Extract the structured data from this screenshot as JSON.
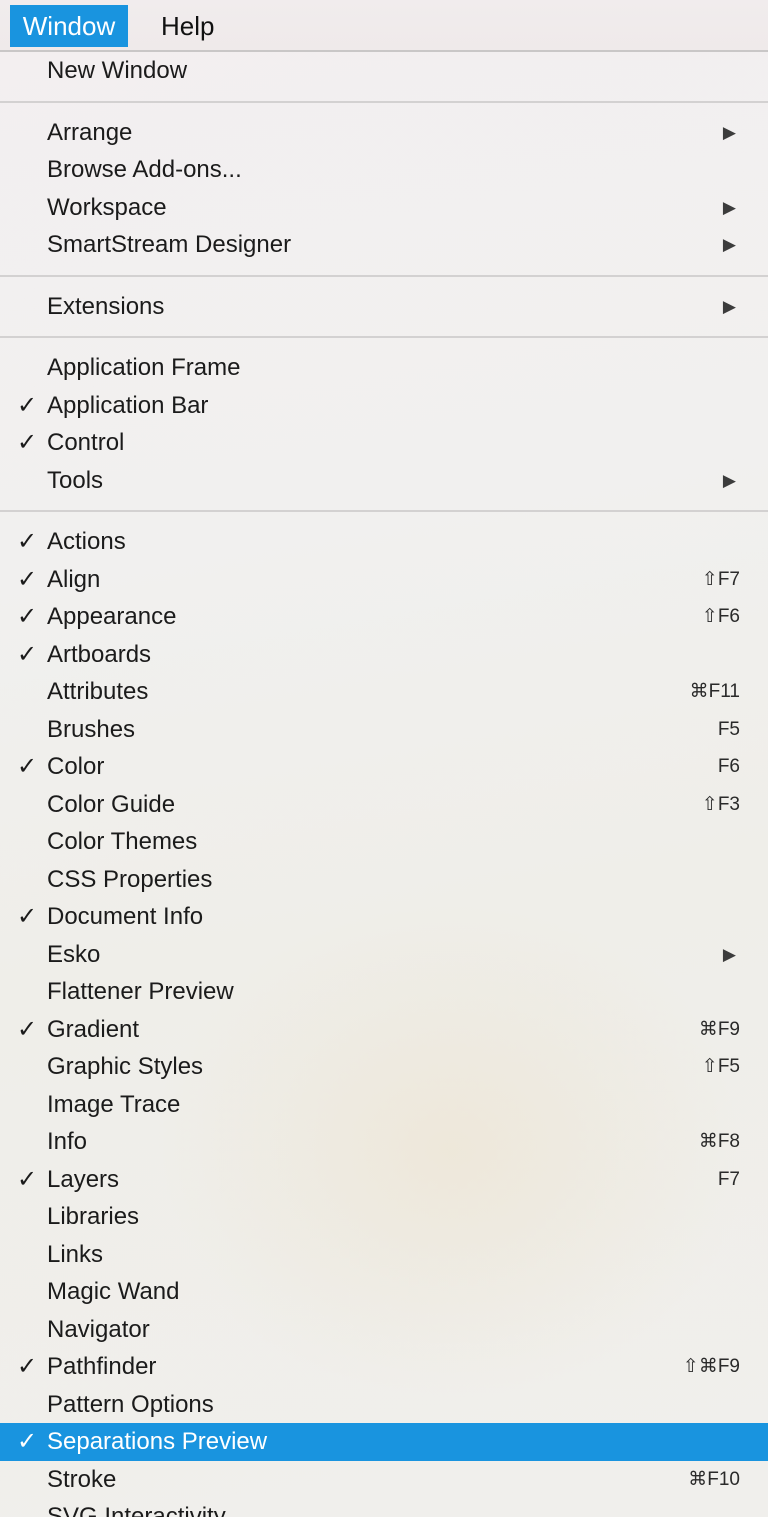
{
  "menubar": {
    "window_label": "Window",
    "help_label": "Help"
  },
  "colors": {
    "highlight": "#1994df",
    "separator": "#d3d1d1"
  },
  "icons": {
    "check": "✓",
    "submenu_arrow": "▶"
  },
  "groups": [
    [
      {
        "label": "New Window",
        "checked": false,
        "submenu": false,
        "shortcut": ""
      }
    ],
    [
      {
        "label": "Arrange",
        "checked": false,
        "submenu": true,
        "shortcut": ""
      },
      {
        "label": "Browse Add-ons...",
        "checked": false,
        "submenu": false,
        "shortcut": ""
      },
      {
        "label": "Workspace",
        "checked": false,
        "submenu": true,
        "shortcut": ""
      },
      {
        "label": "SmartStream Designer",
        "checked": false,
        "submenu": true,
        "shortcut": ""
      }
    ],
    [
      {
        "label": "Extensions",
        "checked": false,
        "submenu": true,
        "shortcut": ""
      }
    ],
    [
      {
        "label": "Application Frame",
        "checked": false,
        "submenu": false,
        "shortcut": ""
      },
      {
        "label": "Application Bar",
        "checked": true,
        "submenu": false,
        "shortcut": ""
      },
      {
        "label": "Control",
        "checked": true,
        "submenu": false,
        "shortcut": ""
      },
      {
        "label": "Tools",
        "checked": false,
        "submenu": true,
        "shortcut": ""
      }
    ],
    [
      {
        "label": "Actions",
        "checked": true,
        "submenu": false,
        "shortcut": ""
      },
      {
        "label": "Align",
        "checked": true,
        "submenu": false,
        "shortcut": "⇧F7"
      },
      {
        "label": "Appearance",
        "checked": true,
        "submenu": false,
        "shortcut": "⇧F6"
      },
      {
        "label": "Artboards",
        "checked": true,
        "submenu": false,
        "shortcut": ""
      },
      {
        "label": "Attributes",
        "checked": false,
        "submenu": false,
        "shortcut": "⌘F11"
      },
      {
        "label": "Brushes",
        "checked": false,
        "submenu": false,
        "shortcut": "F5"
      },
      {
        "label": "Color",
        "checked": true,
        "submenu": false,
        "shortcut": "F6"
      },
      {
        "label": "Color Guide",
        "checked": false,
        "submenu": false,
        "shortcut": "⇧F3"
      },
      {
        "label": "Color Themes",
        "checked": false,
        "submenu": false,
        "shortcut": ""
      },
      {
        "label": "CSS Properties",
        "checked": false,
        "submenu": false,
        "shortcut": ""
      },
      {
        "label": "Document Info",
        "checked": true,
        "submenu": false,
        "shortcut": ""
      },
      {
        "label": "Esko",
        "checked": false,
        "submenu": true,
        "shortcut": ""
      },
      {
        "label": "Flattener Preview",
        "checked": false,
        "submenu": false,
        "shortcut": ""
      },
      {
        "label": "Gradient",
        "checked": true,
        "submenu": false,
        "shortcut": "⌘F9"
      },
      {
        "label": "Graphic Styles",
        "checked": false,
        "submenu": false,
        "shortcut": "⇧F5"
      },
      {
        "label": "Image Trace",
        "checked": false,
        "submenu": false,
        "shortcut": ""
      },
      {
        "label": "Info",
        "checked": false,
        "submenu": false,
        "shortcut": "⌘F8"
      },
      {
        "label": "Layers",
        "checked": true,
        "submenu": false,
        "shortcut": "F7"
      },
      {
        "label": "Libraries",
        "checked": false,
        "submenu": false,
        "shortcut": ""
      },
      {
        "label": "Links",
        "checked": false,
        "submenu": false,
        "shortcut": ""
      },
      {
        "label": "Magic Wand",
        "checked": false,
        "submenu": false,
        "shortcut": ""
      },
      {
        "label": "Navigator",
        "checked": false,
        "submenu": false,
        "shortcut": ""
      },
      {
        "label": "Pathfinder",
        "checked": true,
        "submenu": false,
        "shortcut": "⇧⌘F9"
      },
      {
        "label": "Pattern Options",
        "checked": false,
        "submenu": false,
        "shortcut": ""
      },
      {
        "label": "Separations Preview",
        "checked": true,
        "submenu": false,
        "shortcut": "",
        "highlighted": true
      },
      {
        "label": "Stroke",
        "checked": false,
        "submenu": false,
        "shortcut": "⌘F10"
      },
      {
        "label": "SVG Interactivity",
        "checked": false,
        "submenu": false,
        "shortcut": ""
      }
    ]
  ]
}
